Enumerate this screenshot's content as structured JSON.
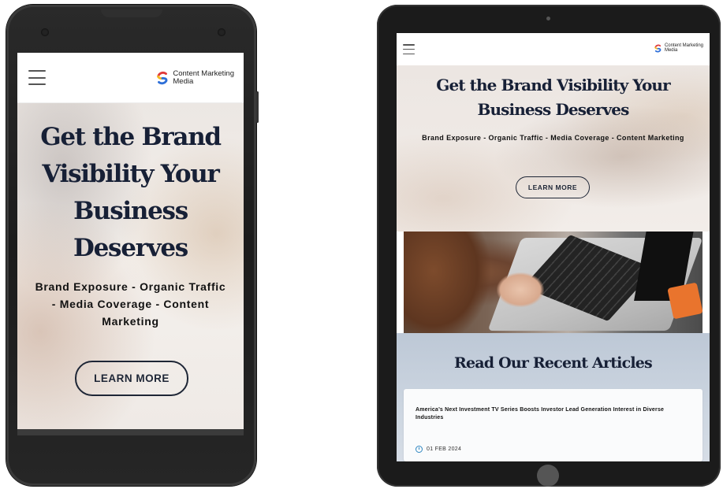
{
  "brand": {
    "name": "Content Marketing Media",
    "name_line1": "Content Marketing",
    "name_line2": "Media",
    "colors": {
      "logo_red": "#e03a3a",
      "logo_yellow": "#f5b921",
      "logo_blue": "#2e6fd8",
      "heading": "#172036"
    }
  },
  "hero": {
    "title": "Get the Brand Visibility Your Business Deserves",
    "subtitle": "Brand Exposure - Organic Traffic - Media Coverage - Content Marketing",
    "cta_label": "LEARN MORE"
  },
  "articles": {
    "heading": "Read Our Recent Articles",
    "items": [
      {
        "title": "America’s Next Investment TV Series Boosts Investor Lead Generation Interest in Diverse Industries",
        "date": "01 FEB 2024"
      }
    ]
  },
  "icons": {
    "menu": "hamburger-icon",
    "logo": "logo-icon",
    "date": "clock-icon"
  }
}
